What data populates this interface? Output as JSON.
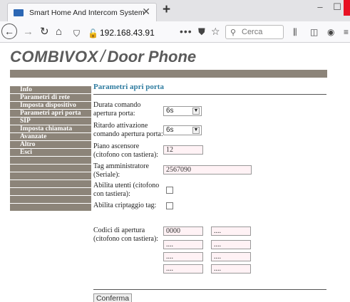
{
  "browser": {
    "tab_title": "Smart Home And Intercom System",
    "tab_close": "✕",
    "new_tab": "+",
    "url": "192.168.43.91",
    "search_placeholder": "Cerca",
    "page_actions": "•••"
  },
  "logo": {
    "brand": "COMBIVOX",
    "slash": "/",
    "sub": "Door Phone"
  },
  "sidebar": {
    "items": [
      {
        "label": "Info"
      },
      {
        "label": "Parametri di rete"
      },
      {
        "label": "Imposta dispositivo"
      },
      {
        "label": "Parametri apri porta"
      },
      {
        "label": "SIP"
      },
      {
        "label": "Imposta chiamata"
      },
      {
        "label": "Avanzate"
      },
      {
        "label": "Altro"
      },
      {
        "label": "Esci"
      }
    ]
  },
  "section": {
    "title": "Parametri apri porta",
    "door_open_duration": {
      "label": "Durata comando apertura porta:",
      "value": "6s"
    },
    "door_open_delay": {
      "label": "Ritardo attivazione comando apertura porta:",
      "value": "6s"
    },
    "elevator_floor": {
      "label": "Piano ascensore (citofono con tastiera):",
      "value": "12"
    },
    "admin_tag": {
      "label": "Tag amministratore (Seriale):",
      "value": "2567090"
    },
    "enable_users": {
      "label": "Abilita utenti (citofono con tastiera):"
    },
    "enable_tag_crypto": {
      "label": "Abilita criptaggio tag:"
    },
    "open_codes": {
      "label": "Codici di apertura (citofono con tastiera):",
      "values": [
        "0000",
        "....",
        "....",
        "....",
        "....",
        "....",
        "....",
        "...."
      ]
    },
    "confirm_label": "Conferma"
  },
  "colors": {
    "menu_bg": "#8c8479",
    "title": "#2f7ca0",
    "input_bg": "#fff2f5"
  }
}
